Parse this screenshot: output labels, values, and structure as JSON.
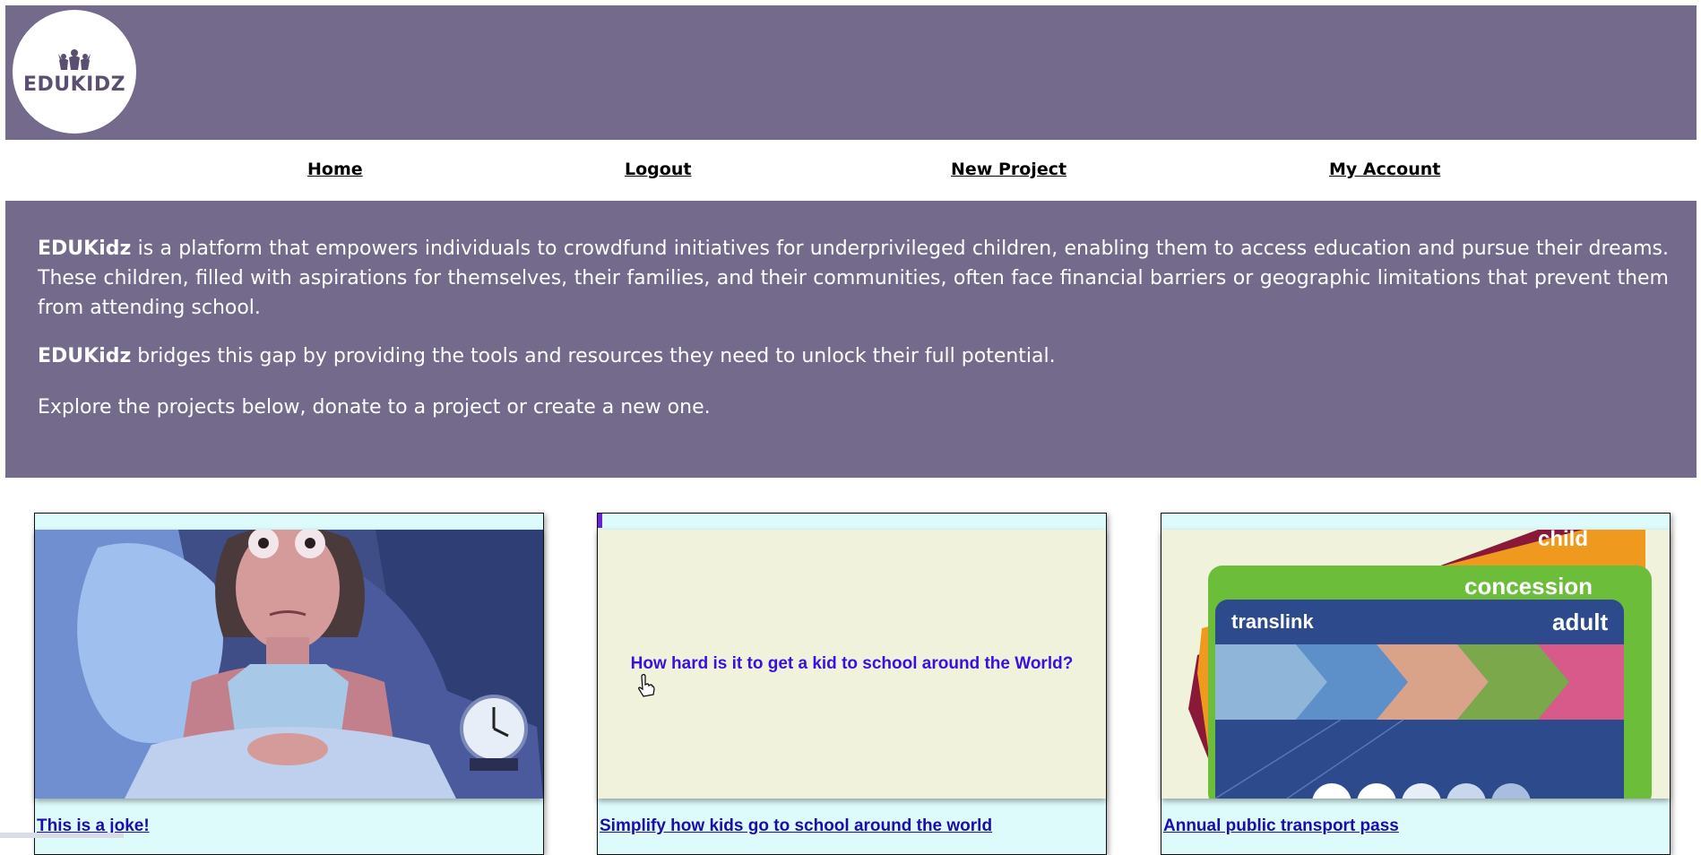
{
  "header": {
    "logo_text": "EDUKIDZ",
    "bg_color": "#736a8c"
  },
  "nav": {
    "items": [
      {
        "label": "Home"
      },
      {
        "label": "Logout"
      },
      {
        "label": "New Project"
      },
      {
        "label": "My Account"
      }
    ]
  },
  "intro": {
    "brand": "EDUKidz",
    "p1_rest": " is a platform that empowers individuals to crowdfund initiatives for underprivileged children, enabling them to access education and pursue their dreams. These children, filled with aspirations for themselves, their families, and their communities, often face financial barriers or geographic limitations that prevent them from attending school.",
    "p2_rest": " bridges this gap by providing the tools and resources they need to unlock their full potential.",
    "p3": "Explore the projects below, donate to a project or create a new one."
  },
  "projects": [
    {
      "title": "This is a joke!",
      "image_icon": "sleepless-woman-illustration"
    },
    {
      "title": "Simplify how kids go to school around the world",
      "image_alt": "How hard is it to get a kid to school around the World?"
    },
    {
      "title": "Annual public transport pass",
      "image_icon": "translink-cards-image",
      "card_labels": {
        "child": "child",
        "concession": "concession",
        "adult": "adult",
        "brand": "translink"
      }
    }
  ]
}
